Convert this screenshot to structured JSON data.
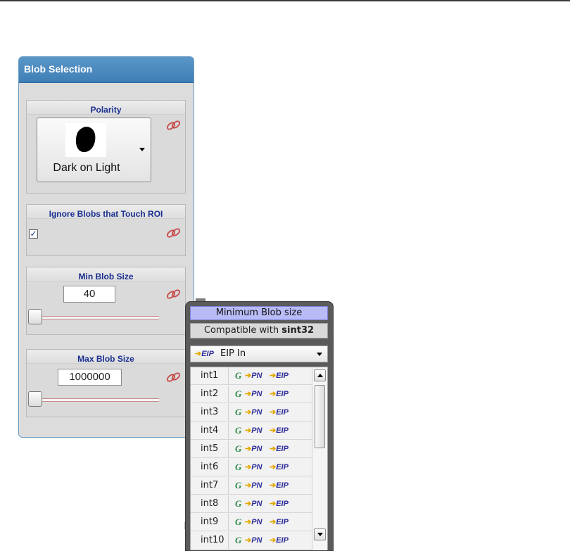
{
  "panel": {
    "title": "Blob Selection",
    "accent_color": "#4a8ac0"
  },
  "polarity": {
    "title": "Polarity",
    "value": "Dark on Light",
    "link_icon": "link-icon"
  },
  "ignore_blobs": {
    "title": "Ignore Blobs that Touch ROI",
    "checked": true,
    "check_mark": "✓"
  },
  "min_blob": {
    "title": "Min Blob Size",
    "value": "40",
    "slider_fraction": 0.0
  },
  "max_blob": {
    "title": "Max Blob Size",
    "value": "1000000",
    "slider_fraction": 0.0
  },
  "popup": {
    "title": "Minimum Blob size",
    "compat_prefix": "Compatible with ",
    "compat_type": "sint32",
    "source_badge": "EIP",
    "source_label": "EIP In",
    "rows": [
      {
        "label": "int1"
      },
      {
        "label": "int2"
      },
      {
        "label": "int3"
      },
      {
        "label": "int4"
      },
      {
        "label": "int5"
      },
      {
        "label": "int6"
      },
      {
        "label": "int7"
      },
      {
        "label": "int8"
      },
      {
        "label": "int9"
      },
      {
        "label": "int10"
      }
    ],
    "badges": {
      "g": "G",
      "pn": "PN",
      "eip": "EIP"
    }
  }
}
